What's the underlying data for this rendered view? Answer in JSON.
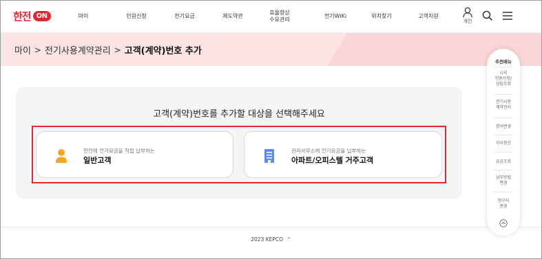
{
  "header": {
    "logo_text": "한전",
    "logo_on": "ON",
    "nav": [
      "마이",
      "민원신청",
      "전기요금",
      "제도약관",
      "효율향상\n수요관리",
      "전기WiKi",
      "위치찾기",
      "고객지원"
    ],
    "user_label": "개인"
  },
  "breadcrumb": {
    "items": [
      "마이",
      "전기사용계약관리"
    ],
    "current": "고객(계약)번호 추가",
    "separator": ">"
  },
  "main": {
    "prompt": "고객(계약)번호를 추가할 대상을 선택해주세요",
    "options": [
      {
        "sub": "한전에 전기요금을 직접 납부하는",
        "title": "일반고객",
        "icon": "person-icon"
      },
      {
        "sub": "관리사무소에 전기요금을 납부하는",
        "title": "아파트/오피스텔 거주고객",
        "icon": "building-icon"
      }
    ]
  },
  "quick_menu": {
    "title": "추천메뉴",
    "items": [
      "나의\n민원신청/\n상담조회",
      "전기사용\n계약관리",
      "명의변경",
      "이사정산",
      "요금조회",
      "납부방법\n변경",
      "청구서\n변경"
    ]
  },
  "footer": {
    "text": "2023 KEPCO"
  },
  "colors": {
    "brand": "#e8262e",
    "band": "#fde3e3",
    "highlight": "#e02a2a",
    "person": "#f5a623",
    "building": "#5b8def"
  }
}
